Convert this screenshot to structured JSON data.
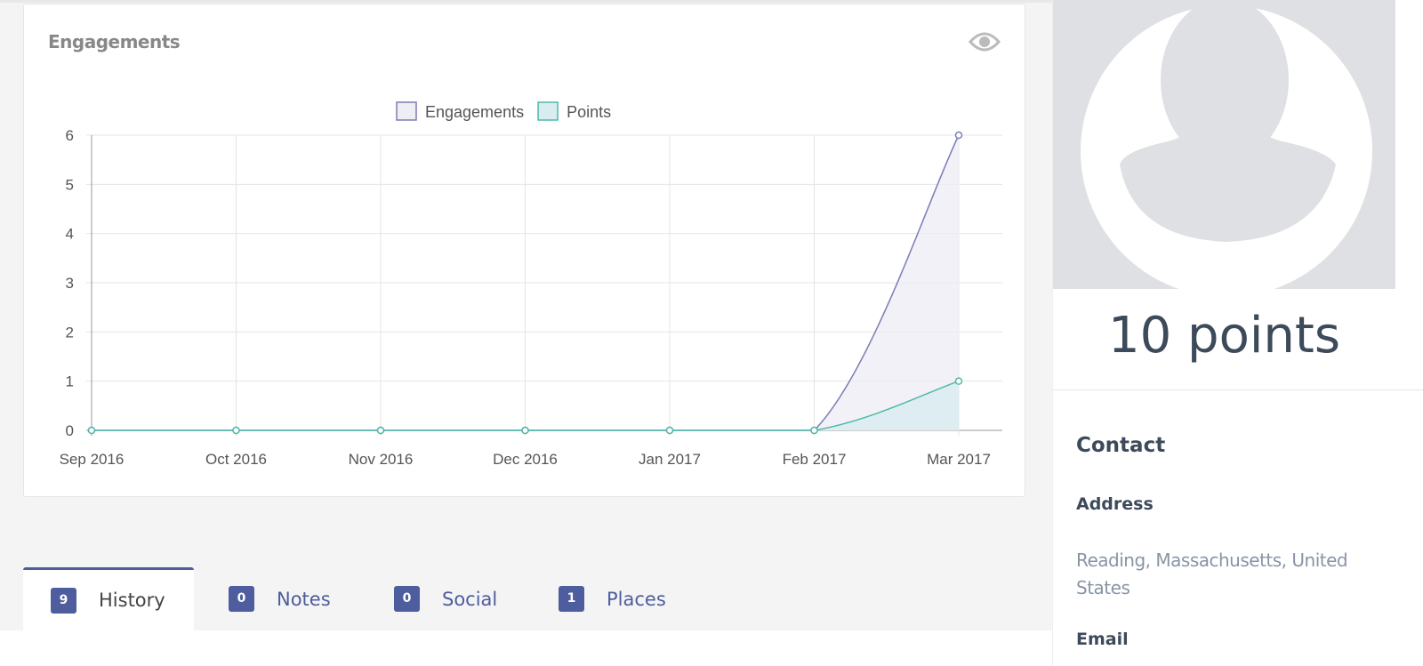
{
  "card": {
    "title": "Engagements",
    "icon": "eye-icon"
  },
  "chart_data": {
    "type": "line",
    "categories": [
      "Sep 2016",
      "Oct 2016",
      "Nov 2016",
      "Dec 2016",
      "Jan 2017",
      "Feb 2017",
      "Mar 2017"
    ],
    "series": [
      {
        "name": "Engagements",
        "values": [
          0,
          0,
          0,
          0,
          0,
          0,
          6
        ],
        "color": "#7b7db5",
        "fill": "#eeeef5"
      },
      {
        "name": "Points",
        "values": [
          0,
          0,
          0,
          0,
          0,
          0,
          1
        ],
        "color": "#4fb9a9",
        "fill": "#d9ecef"
      }
    ],
    "ylim": [
      0,
      6
    ],
    "yticks": [
      "0",
      "1",
      "2",
      "3",
      "4",
      "5",
      "6"
    ],
    "legend": "top",
    "grid": true
  },
  "profile": {
    "points": "10 points",
    "contact_heading": "Contact",
    "address_label": "Address",
    "address": "Reading, Massachusetts, United States",
    "email_label": "Email"
  },
  "tabs": [
    {
      "count": "9",
      "label": "History",
      "active": true
    },
    {
      "count": "0",
      "label": "Notes"
    },
    {
      "count": "0",
      "label": "Social"
    },
    {
      "count": "1",
      "label": "Places"
    }
  ]
}
